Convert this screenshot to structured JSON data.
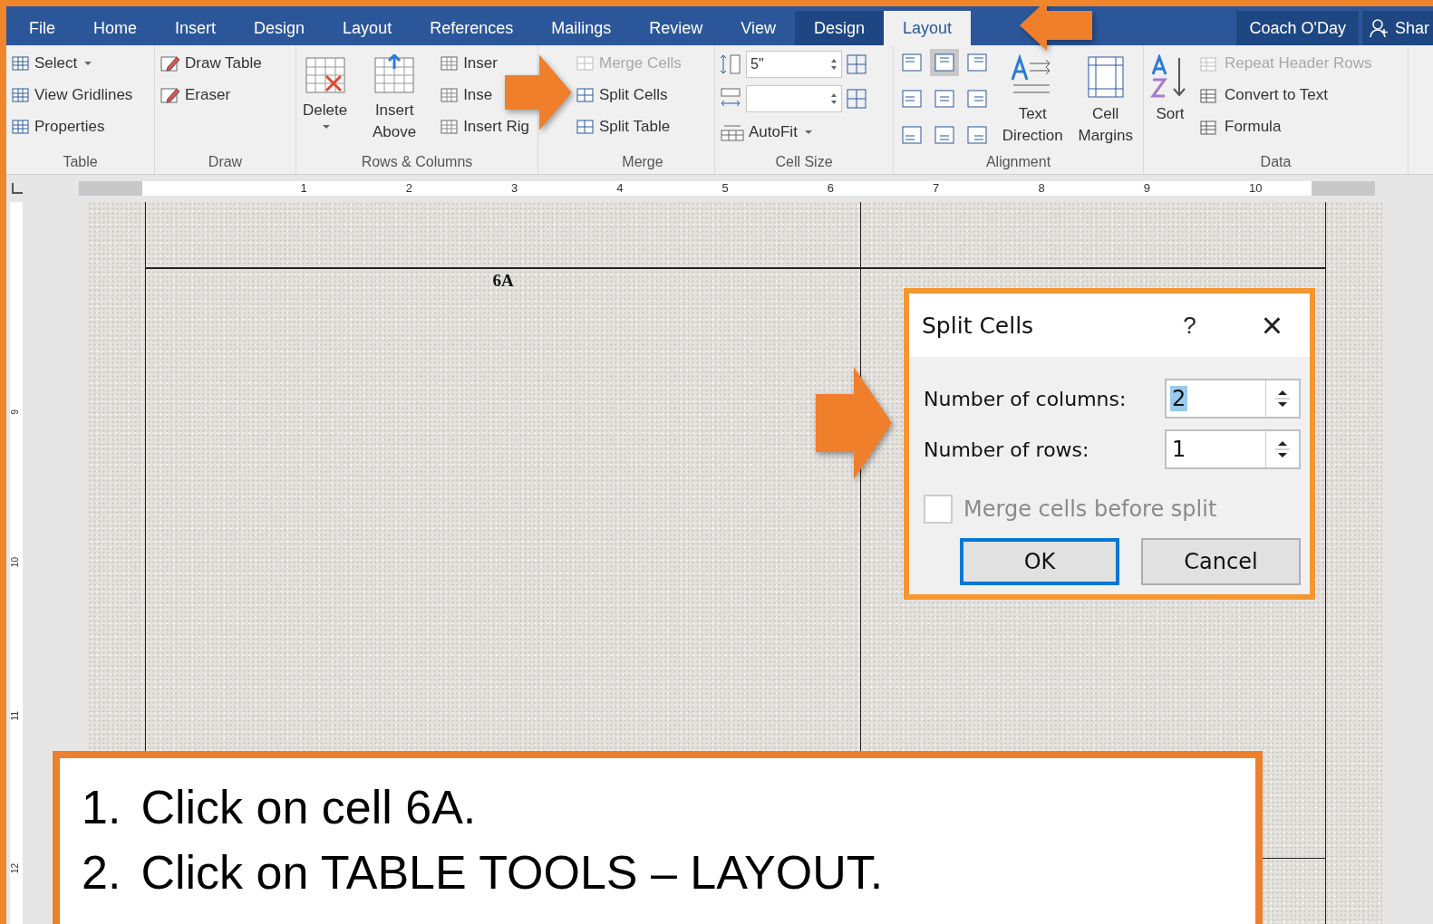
{
  "tabs": [
    {
      "label": "File",
      "selected": false,
      "kind": "plain"
    },
    {
      "label": "Home",
      "selected": false,
      "kind": "plain"
    },
    {
      "label": "Insert",
      "selected": false,
      "kind": "plain"
    },
    {
      "label": "Design",
      "selected": false,
      "kind": "plain"
    },
    {
      "label": "Layout",
      "selected": false,
      "kind": "plain"
    },
    {
      "label": "References",
      "selected": false,
      "kind": "plain"
    },
    {
      "label": "Mailings",
      "selected": false,
      "kind": "plain"
    },
    {
      "label": "Review",
      "selected": false,
      "kind": "plain"
    },
    {
      "label": "View",
      "selected": false,
      "kind": "plain"
    },
    {
      "label": "Design",
      "selected": false,
      "kind": "context"
    },
    {
      "label": "Layout",
      "selected": true,
      "kind": "context"
    }
  ],
  "account": {
    "user": "Coach O'Day",
    "share": "Shar"
  },
  "ribbon": {
    "table": {
      "label": "Table",
      "items": [
        {
          "label": "Select",
          "dropdown": true,
          "disabled": false
        },
        {
          "label": "View Gridlines",
          "disabled": false
        },
        {
          "label": "Properties",
          "disabled": false
        }
      ]
    },
    "draw": {
      "label": "Draw",
      "items": [
        {
          "label": "Draw Table",
          "disabled": false
        },
        {
          "label": "Eraser",
          "disabled": false
        }
      ]
    },
    "rows_columns": {
      "label": "Rows & Columns",
      "big": [
        {
          "label": "Delete",
          "dropdown": true
        },
        {
          "label": "Insert Above"
        }
      ],
      "items": [
        {
          "label": "Inser",
          "disabled": false
        },
        {
          "label": "Inse",
          "disabled": false
        },
        {
          "label": "Insert Rig",
          "disabled": false
        }
      ]
    },
    "merge": {
      "label": "Merge",
      "items": [
        {
          "label": "Merge Cells",
          "disabled": true
        },
        {
          "label": "Split Cells",
          "disabled": false
        },
        {
          "label": "Split Table",
          "disabled": false
        }
      ]
    },
    "cell_size": {
      "label": "Cell Size",
      "height": "5\"",
      "autofit": "AutoFit"
    },
    "alignment": {
      "label": "Alignment",
      "buttons": [
        {
          "selected": false
        },
        {
          "selected": true
        },
        {
          "selected": false
        },
        {
          "selected": false
        },
        {
          "selected": false
        },
        {
          "selected": false
        },
        {
          "selected": false
        },
        {
          "selected": false
        },
        {
          "selected": false
        }
      ],
      "big": [
        {
          "label": "Text Direction"
        },
        {
          "label": "Cell Margins"
        }
      ]
    },
    "data": {
      "label": "Data",
      "sort": "Sort",
      "items": [
        {
          "label": "Repeat Header Rows",
          "disabled": true
        },
        {
          "label": "Convert to Text",
          "disabled": false
        },
        {
          "label": "Formula",
          "disabled": false
        }
      ]
    }
  },
  "ruler": {
    "numbers": [
      "1",
      "2",
      "3",
      "4",
      "5",
      "6",
      "7",
      "8",
      "9",
      "10"
    ]
  },
  "vertical_ruler": {
    "numbers": [
      "9",
      "10",
      "11",
      "12"
    ]
  },
  "document": {
    "cell_label": "6A"
  },
  "dialog": {
    "title": "Split Cells",
    "help": "?",
    "close": "×",
    "fields": [
      {
        "label": "Number of columns:",
        "value": "2",
        "selected": true
      },
      {
        "label": "Number of rows:",
        "value": "1",
        "selected": false
      }
    ],
    "merge_checkbox": {
      "label": "Merge cells before split",
      "checked": false,
      "disabled": true
    },
    "buttons": [
      {
        "label": "OK",
        "default": true
      },
      {
        "label": "Cancel",
        "default": false
      }
    ]
  },
  "instructions": [
    {
      "number": "1.",
      "text": "Click on cell 6A."
    },
    {
      "number": "2.",
      "text": "Click on TABLE TOOLS – LAYOUT."
    }
  ]
}
